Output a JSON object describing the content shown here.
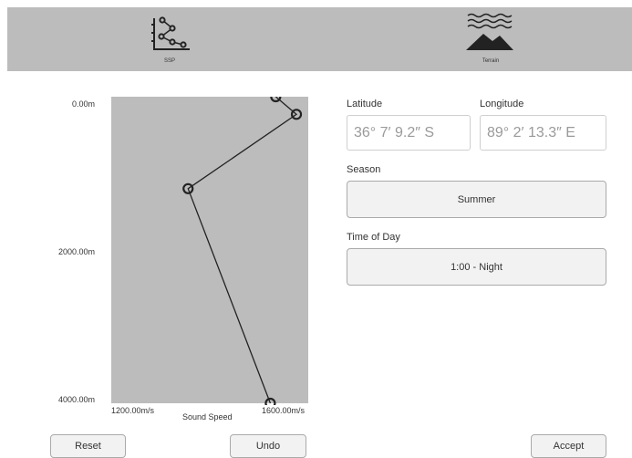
{
  "tabs": [
    {
      "label": "SSP",
      "icon": "ssp-graph-icon"
    },
    {
      "label": "Terrain",
      "icon": "terrain-icon"
    }
  ],
  "ssp_chart": {
    "depth_labels": [
      "0.00m",
      "2000.00m",
      "4000.00m"
    ],
    "xaxis_min_label": "1200.00m/s",
    "xaxis_max_label": "1600.00m/s",
    "xaxis_title": "Sound Speed"
  },
  "chart_data": {
    "type": "line",
    "xlabel": "Sound Speed",
    "ylabel": "",
    "xlim": [
      1200,
      1600
    ],
    "ylim": [
      0,
      4000
    ],
    "y_inverted": true,
    "x_tick_labels": [
      "1200.00m/s",
      "1600.00m/s"
    ],
    "y_tick_labels": [
      "0.00m",
      "2000.00m",
      "4000.00m"
    ],
    "points": [
      {
        "x": 1534,
        "y": 0
      },
      {
        "x": 1576,
        "y": 230
      },
      {
        "x": 1356,
        "y": 1200
      },
      {
        "x": 1523,
        "y": 4000
      }
    ],
    "grid": false,
    "background": "#bcbcbc",
    "line_color": "#222222"
  },
  "location": {
    "latitude_label": "Latitude",
    "latitude_value": "36° 7′ 9.2″ S",
    "longitude_label": "Longitude",
    "longitude_value": "89° 2′ 13.3″ E"
  },
  "season": {
    "label": "Season",
    "value": "Summer"
  },
  "time_of_day": {
    "label": "Time of Day",
    "value": "1:00 - Night"
  },
  "actions": {
    "reset": "Reset",
    "undo": "Undo",
    "accept": "Accept"
  },
  "colors": {
    "toolbar_bg": "#bcbcbc",
    "plot_bg": "#bcbcbc",
    "button_bg": "#f2f2f2"
  }
}
